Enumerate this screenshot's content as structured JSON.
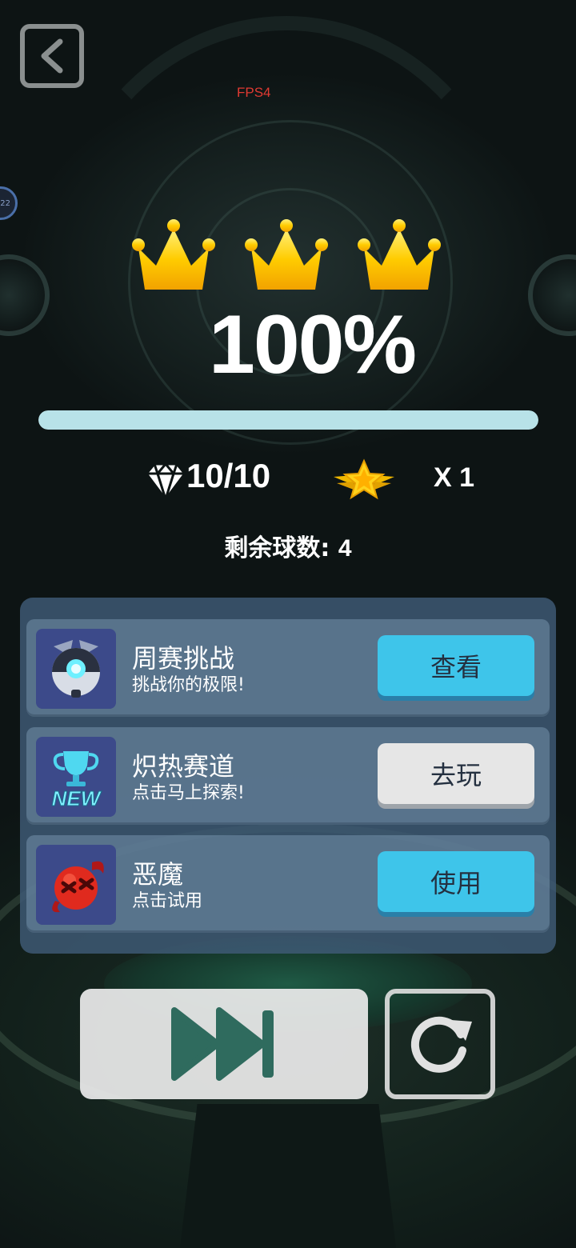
{
  "hud": {
    "fps_label": "FPS4",
    "level_badge": "22"
  },
  "result": {
    "crowns_earned": 3,
    "crowns_total": 3,
    "percent_text": "100%",
    "progress_fraction": 1.0,
    "gems_text": "10/10",
    "stars_text": "X 1",
    "balls_remaining_label": "剩余球数:",
    "balls_remaining_value": "4"
  },
  "offers": [
    {
      "title": "周赛挑战",
      "subtitle": "挑战你的极限!",
      "button": "查看",
      "button_style": "blue",
      "icon": "robot-ball-icon"
    },
    {
      "title": "炽热赛道",
      "subtitle": "点击马上探索!",
      "button": "去玩",
      "button_style": "gray",
      "icon": "trophy-new-icon"
    },
    {
      "title": "恶魔",
      "subtitle": "点击试用",
      "button": "使用",
      "button_style": "blue",
      "icon": "devil-ball-icon"
    }
  ],
  "controls": {
    "skip_icon": "fast-forward-icon",
    "retry_icon": "refresh-icon"
  },
  "colors": {
    "crown": "#ffcc00",
    "progress_fill": "#b8e2e8",
    "accent_blue": "#3ec5ea",
    "fps_red": "#e03a32"
  }
}
